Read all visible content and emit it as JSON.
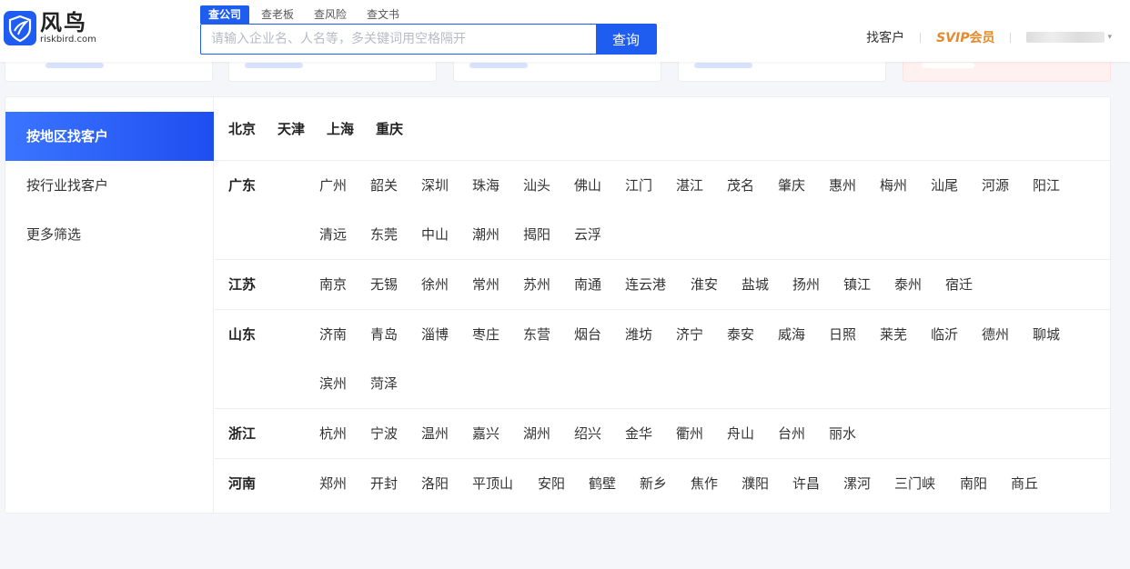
{
  "brand": {
    "name_cn": "风鸟",
    "name_en": "riskbird.com"
  },
  "search": {
    "tabs": [
      "查公司",
      "查老板",
      "查风险",
      "查文书"
    ],
    "active_tab": 0,
    "placeholder": "请输入企业名、人名等，多关键词用空格隔开",
    "button": "查询"
  },
  "header": {
    "find_customer": "找客户",
    "vip_prefix": "SVIP",
    "vip_suffix": "会员"
  },
  "sidebar": {
    "items": [
      "按地区找客户",
      "按行业找客户",
      "更多筛选"
    ],
    "active": 0
  },
  "municipalities": [
    "北京",
    "天津",
    "上海",
    "重庆"
  ],
  "provinces": [
    {
      "name": "广东",
      "cities": [
        "广州",
        "韶关",
        "深圳",
        "珠海",
        "汕头",
        "佛山",
        "江门",
        "湛江",
        "茂名",
        "肇庆",
        "惠州",
        "梅州",
        "汕尾",
        "河源",
        "阳江",
        "清远",
        "东莞",
        "中山",
        "潮州",
        "揭阳",
        "云浮"
      ]
    },
    {
      "name": "江苏",
      "cities": [
        "南京",
        "无锡",
        "徐州",
        "常州",
        "苏州",
        "南通",
        "连云港",
        "淮安",
        "盐城",
        "扬州",
        "镇江",
        "泰州",
        "宿迁"
      ]
    },
    {
      "name": "山东",
      "cities": [
        "济南",
        "青岛",
        "淄博",
        "枣庄",
        "东营",
        "烟台",
        "潍坊",
        "济宁",
        "泰安",
        "威海",
        "日照",
        "莱芜",
        "临沂",
        "德州",
        "聊城",
        "滨州",
        "菏泽"
      ]
    },
    {
      "name": "浙江",
      "cities": [
        "杭州",
        "宁波",
        "温州",
        "嘉兴",
        "湖州",
        "绍兴",
        "金华",
        "衢州",
        "舟山",
        "台州",
        "丽水"
      ]
    },
    {
      "name": "河南",
      "cities": [
        "郑州",
        "开封",
        "洛阳",
        "平顶山",
        "安阳",
        "鹤壁",
        "新乡",
        "焦作",
        "濮阳",
        "许昌",
        "漯河",
        "三门峡",
        "南阳",
        "商丘"
      ]
    }
  ],
  "colors": {
    "accent": "#1f5cf0",
    "vip": "#e48a2c"
  }
}
